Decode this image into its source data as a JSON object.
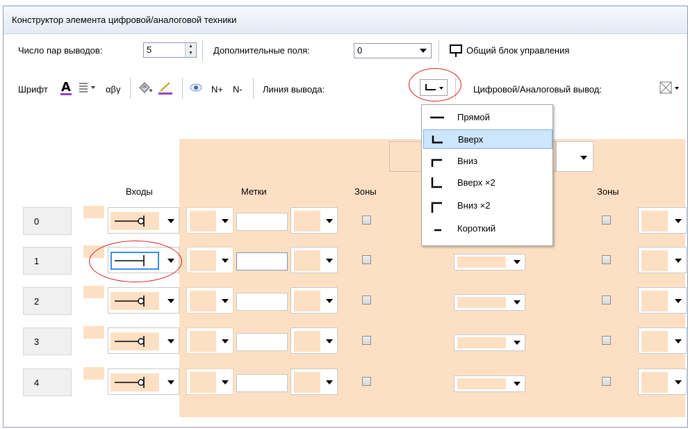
{
  "window": {
    "title": "Конструктор элемента цифровой/аналоговой техники"
  },
  "toolbar1": {
    "pin_pairs_label": "Число пар выводов:",
    "pin_pairs_value": "5",
    "extra_fields_label": "Дополнительные поля:",
    "extra_fields_value": "0",
    "common_block_label": "Общий блок управления"
  },
  "toolbar2": {
    "font_label": "Шрифт",
    "greek_label": "αβγ",
    "n_plus": "N+",
    "n_minus": "N-",
    "pin_line_label": "Линия вывода:",
    "digital_analog_label": "Цифровой/Аналоговый вывод:"
  },
  "headers": {
    "inputs": "Входы",
    "labels": "Метки",
    "zones_left": "Зоны",
    "zones_right": "Зоны"
  },
  "rows": [
    {
      "num": "0"
    },
    {
      "num": "1"
    },
    {
      "num": "2"
    },
    {
      "num": "3"
    },
    {
      "num": "4"
    }
  ],
  "pin_line_menu": {
    "items": [
      {
        "label": "Прямой",
        "icon": "straight-line-icon"
      },
      {
        "label": "Вверх",
        "icon": "line-up-icon",
        "selected": true
      },
      {
        "label": "Вниз",
        "icon": "line-down-icon"
      },
      {
        "label": "Вверх ×2",
        "icon": "line-up-x2-icon"
      },
      {
        "label": "Вниз ×2",
        "icon": "line-down-x2-icon"
      },
      {
        "label": "Короткий",
        "icon": "short-line-icon"
      }
    ]
  },
  "colors": {
    "peach": "#fde0c4",
    "selection": "#cde6fb",
    "highlight_red": "#d91c1c",
    "font_underline": "#9b3fc9"
  }
}
